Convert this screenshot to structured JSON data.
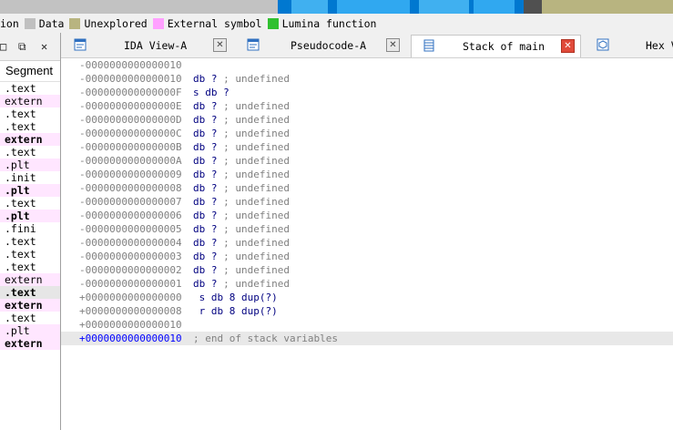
{
  "legend": {
    "items": [
      {
        "label": "ion",
        "color": ""
      },
      {
        "label": "Data",
        "color": "#c0c0c0"
      },
      {
        "label": "Unexplored",
        "color": "#b8b480"
      },
      {
        "label": "External symbol",
        "color": "#ffa0ff"
      },
      {
        "label": "Lumina function",
        "color": "#30c030"
      }
    ]
  },
  "segments_panel": {
    "header": "Segment",
    "toolbar_icons": [
      "restore-icon",
      "float-icon",
      "close-icon"
    ],
    "rows": [
      {
        "name": ".text",
        "type": "plain"
      },
      {
        "name": "extern",
        "type": "ext"
      },
      {
        "name": ".text",
        "type": "plain"
      },
      {
        "name": ".text",
        "type": "plain"
      },
      {
        "name": "extern",
        "type": "ext-bold"
      },
      {
        "name": ".text",
        "type": "plain"
      },
      {
        "name": ".plt",
        "type": "ext"
      },
      {
        "name": ".init",
        "type": "plain"
      },
      {
        "name": ".plt",
        "type": "ext-bold"
      },
      {
        "name": ".text",
        "type": "plain"
      },
      {
        "name": ".plt",
        "type": "ext-bold"
      },
      {
        "name": ".fini",
        "type": "plain"
      },
      {
        "name": ".text",
        "type": "plain"
      },
      {
        "name": ".text",
        "type": "plain"
      },
      {
        "name": ".text",
        "type": "plain"
      },
      {
        "name": "extern",
        "type": "ext"
      },
      {
        "name": ".text",
        "type": "sel-bold"
      },
      {
        "name": "extern",
        "type": "ext-bold"
      },
      {
        "name": ".text",
        "type": "plain"
      },
      {
        "name": ".plt",
        "type": "ext"
      },
      {
        "name": "extern",
        "type": "ext-bold"
      }
    ]
  },
  "tabs": [
    {
      "label": "IDA View-A",
      "icon": "disassembly-icon",
      "active": false
    },
    {
      "label": "Pseudocode-A",
      "icon": "pseudocode-icon",
      "active": false
    },
    {
      "label": "Stack of main",
      "icon": "stack-icon",
      "active": true
    },
    {
      "label": "Hex V",
      "icon": "hex-icon",
      "active": false
    }
  ],
  "stack_lines": [
    {
      "offset": "-0000000000000010",
      "decl": "",
      "comment": ""
    },
    {
      "offset": "-0000000000000010",
      "decl": "db ?",
      "comment": " ; undefined"
    },
    {
      "offset": "-000000000000000F",
      "decl": "s db ?",
      "comment": ""
    },
    {
      "offset": "-000000000000000E",
      "decl": "db ?",
      "comment": " ; undefined"
    },
    {
      "offset": "-000000000000000D",
      "decl": "db ?",
      "comment": " ; undefined"
    },
    {
      "offset": "-000000000000000C",
      "decl": "db ?",
      "comment": " ; undefined"
    },
    {
      "offset": "-000000000000000B",
      "decl": "db ?",
      "comment": " ; undefined"
    },
    {
      "offset": "-000000000000000A",
      "decl": "db ?",
      "comment": " ; undefined"
    },
    {
      "offset": "-0000000000000009",
      "decl": "db ?",
      "comment": " ; undefined"
    },
    {
      "offset": "-0000000000000008",
      "decl": "db ?",
      "comment": " ; undefined"
    },
    {
      "offset": "-0000000000000007",
      "decl": "db ?",
      "comment": " ; undefined"
    },
    {
      "offset": "-0000000000000006",
      "decl": "db ?",
      "comment": " ; undefined"
    },
    {
      "offset": "-0000000000000005",
      "decl": "db ?",
      "comment": " ; undefined"
    },
    {
      "offset": "-0000000000000004",
      "decl": "db ?",
      "comment": " ; undefined"
    },
    {
      "offset": "-0000000000000003",
      "decl": "db ?",
      "comment": " ; undefined"
    },
    {
      "offset": "-0000000000000002",
      "decl": "db ?",
      "comment": " ; undefined"
    },
    {
      "offset": "-0000000000000001",
      "decl": "db ?",
      "comment": " ; undefined"
    },
    {
      "offset": "+0000000000000000",
      "decl": " s db 8 dup(?)",
      "comment": ""
    },
    {
      "offset": "+0000000000000008",
      "decl": " r db 8 dup(?)",
      "comment": ""
    },
    {
      "offset": "+0000000000000010",
      "decl": "",
      "comment": ""
    },
    {
      "offset": "+0000000000000010",
      "decl": "; end of stack variables",
      "comment": "",
      "highlight": true
    }
  ]
}
